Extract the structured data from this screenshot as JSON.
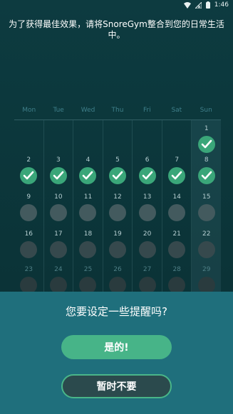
{
  "status_bar": {
    "time": "1:46"
  },
  "headline": "为了获得最佳效果，请将SnoreGym整合到您的日常生活中。",
  "calendar": {
    "weekdays": [
      "Mon",
      "Tue",
      "Wed",
      "Thu",
      "Fri",
      "Sat",
      "Sun"
    ],
    "weeks": [
      [
        null,
        null,
        null,
        null,
        null,
        null,
        {
          "day": "1",
          "state": "done"
        }
      ],
      [
        {
          "day": "2",
          "state": "done"
        },
        {
          "day": "3",
          "state": "done"
        },
        {
          "day": "4",
          "state": "done"
        },
        {
          "day": "5",
          "state": "done"
        },
        {
          "day": "6",
          "state": "done"
        },
        {
          "day": "7",
          "state": "done"
        },
        {
          "day": "8",
          "state": "done"
        }
      ],
      [
        {
          "day": "9",
          "state": "todo"
        },
        {
          "day": "10",
          "state": "todo"
        },
        {
          "day": "11",
          "state": "todo"
        },
        {
          "day": "12",
          "state": "todo"
        },
        {
          "day": "13",
          "state": "todo"
        },
        {
          "day": "14",
          "state": "todo"
        },
        {
          "day": "15",
          "state": "todo"
        }
      ],
      [
        {
          "day": "16",
          "state": "todo"
        },
        {
          "day": "17",
          "state": "todo"
        },
        {
          "day": "18",
          "state": "todo"
        },
        {
          "day": "19",
          "state": "todo"
        },
        {
          "day": "20",
          "state": "todo"
        },
        {
          "day": "21",
          "state": "todo"
        },
        {
          "day": "22",
          "state": "todo"
        }
      ],
      [
        {
          "day": "23",
          "state": "todo"
        },
        {
          "day": "24",
          "state": "todo"
        },
        {
          "day": "25",
          "state": "todo"
        },
        {
          "day": "26",
          "state": "todo"
        },
        {
          "day": "27",
          "state": "todo"
        },
        {
          "day": "28",
          "state": "todo"
        },
        {
          "day": "29",
          "state": "todo"
        }
      ]
    ]
  },
  "dialog": {
    "title": "您要设定一些提醒吗?",
    "yes_label": "是的!",
    "no_label": "暂时不要"
  },
  "colors": {
    "background": "#0d3b40",
    "dialog": "#1f6f7c",
    "accent_green": "#47b488",
    "done_mark": "#3aa679",
    "todo_mark": "#435a5e"
  }
}
